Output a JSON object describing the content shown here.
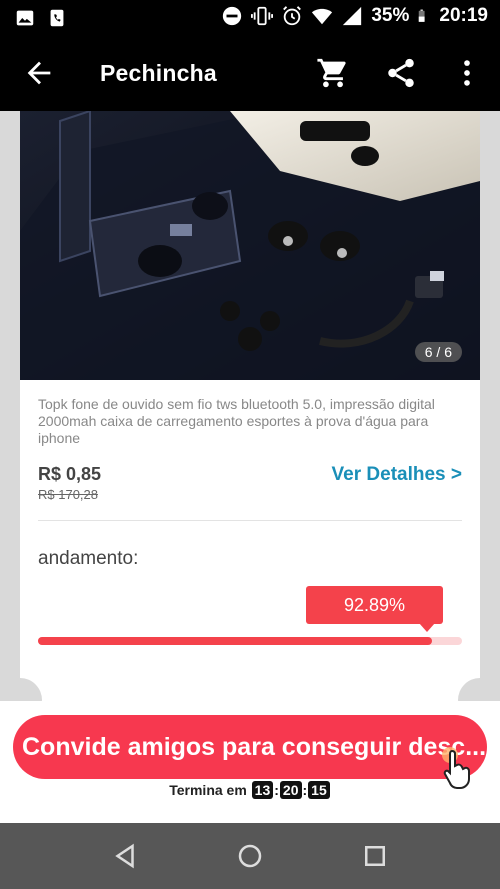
{
  "status_bar": {
    "battery": "35%",
    "time": "20:19",
    "icons": [
      "image-icon",
      "phone-icon",
      "dnd-icon",
      "vibrate-icon",
      "alarm-icon",
      "wifi-icon",
      "signal-icon",
      "battery-icon"
    ]
  },
  "app_bar": {
    "title": "Pechincha",
    "icons": [
      "back-arrow-icon",
      "cart-icon",
      "share-icon",
      "more-vert-icon"
    ]
  },
  "product": {
    "image_counter": "6 / 6",
    "title": "Topk fone de ouvido sem fio tws bluetooth 5.0, impressão digital 2000mah caixa de carregamento esportes à prova d'água para iphone",
    "price": "R$ 0,85",
    "old_price": "R$ 170,28",
    "details_link": "Ver Detalhes >"
  },
  "progress": {
    "label": "andamento:",
    "percent_text": "92.89%",
    "value": 0.9289
  },
  "invite": {
    "button_label": "Convide amigos para conseguir desc...",
    "countdown_label": "Termina em",
    "hours": "13",
    "minutes": "20",
    "seconds": "15"
  },
  "colors": {
    "accent": "#f4424b",
    "invite_button": "#f7384f",
    "link": "#1a8fb8"
  },
  "nav_bar": {
    "icons": [
      "nav-back-icon",
      "nav-home-icon",
      "nav-recents-icon"
    ]
  }
}
